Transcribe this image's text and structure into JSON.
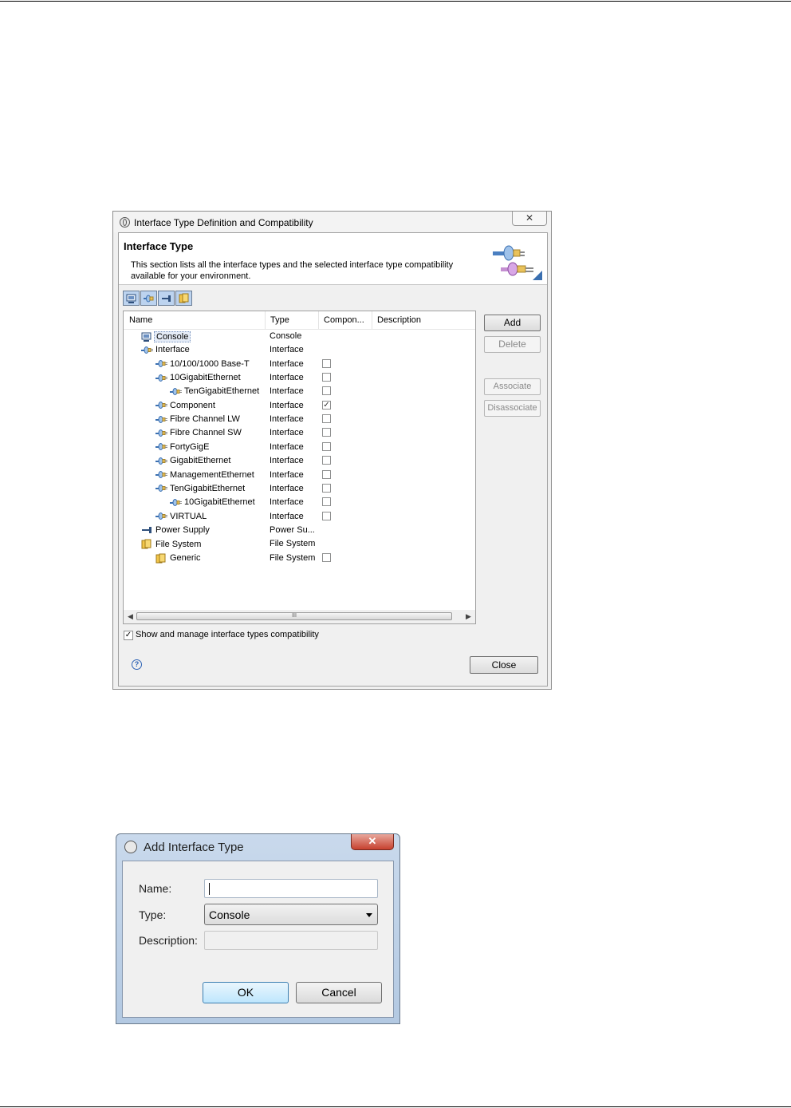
{
  "dialog1": {
    "title": "Interface Type Definition and Compatibility",
    "close_label": "✕",
    "banner": {
      "title": "Interface Type",
      "description": "This section lists all the interface types and the selected interface type compatibility available for your environment."
    },
    "toolbar": [
      "console-filter-icon",
      "interface-filter-icon",
      "power-supply-filter-icon",
      "file-system-filter-icon"
    ],
    "columns": [
      "Name",
      "Type",
      "Compon...",
      "Description"
    ],
    "rows": [
      {
        "name": "Console",
        "type": "Console",
        "icon": "console-icon",
        "level": 0,
        "checkbox": null,
        "selected": true
      },
      {
        "name": "Interface",
        "type": "Interface",
        "icon": "interface-icon",
        "level": 0,
        "checkbox": null
      },
      {
        "name": "10/100/1000 Base-T",
        "type": "Interface",
        "icon": "interface-icon",
        "level": 1,
        "checkbox": false
      },
      {
        "name": "10GigabitEthernet",
        "type": "Interface",
        "icon": "interface-icon",
        "level": 1,
        "checkbox": false
      },
      {
        "name": "TenGigabitEthernet",
        "type": "Interface",
        "icon": "interface-icon",
        "level": 2,
        "checkbox": false
      },
      {
        "name": "Component",
        "type": "Interface",
        "icon": "interface-icon",
        "level": 1,
        "checkbox": true
      },
      {
        "name": "Fibre Channel LW",
        "type": "Interface",
        "icon": "interface-icon",
        "level": 1,
        "checkbox": false
      },
      {
        "name": "Fibre Channel SW",
        "type": "Interface",
        "icon": "interface-icon",
        "level": 1,
        "checkbox": false
      },
      {
        "name": "FortyGigE",
        "type": "Interface",
        "icon": "interface-icon",
        "level": 1,
        "checkbox": false
      },
      {
        "name": "GigabitEthernet",
        "type": "Interface",
        "icon": "interface-icon",
        "level": 1,
        "checkbox": false
      },
      {
        "name": "ManagementEthernet",
        "type": "Interface",
        "icon": "interface-icon",
        "level": 1,
        "checkbox": false
      },
      {
        "name": "TenGigabitEthernet",
        "type": "Interface",
        "icon": "interface-icon",
        "level": 1,
        "checkbox": false
      },
      {
        "name": "10GigabitEthernet",
        "type": "Interface",
        "icon": "interface-icon",
        "level": 2,
        "checkbox": false
      },
      {
        "name": "VIRTUAL",
        "type": "Interface",
        "icon": "interface-icon",
        "level": 1,
        "checkbox": false
      },
      {
        "name": "Power Supply",
        "type": "Power Su...",
        "icon": "power-supply-icon",
        "level": 0,
        "checkbox": null
      },
      {
        "name": "File System",
        "type": "File System",
        "icon": "file-system-icon",
        "level": 0,
        "checkbox": null
      },
      {
        "name": "Generic",
        "type": "File System",
        "icon": "file-system-icon",
        "level": 1,
        "checkbox": false
      }
    ],
    "scrollbar_grip": "III",
    "buttons": {
      "add": "Add",
      "delete": "Delete",
      "associate": "Associate",
      "disassociate": "Disassociate",
      "close": "Close"
    },
    "show_compat": {
      "label": "Show and manage interface types compatibility",
      "checked": true
    },
    "help_glyph": "?"
  },
  "dialog2": {
    "title": "Add Interface Type",
    "close_label": "✕",
    "name_label": "Name:",
    "name_value": "",
    "type_label": "Type:",
    "type_value": "Console",
    "description_label": "Description:",
    "description_value": "",
    "ok_label": "OK",
    "cancel_label": "Cancel"
  }
}
